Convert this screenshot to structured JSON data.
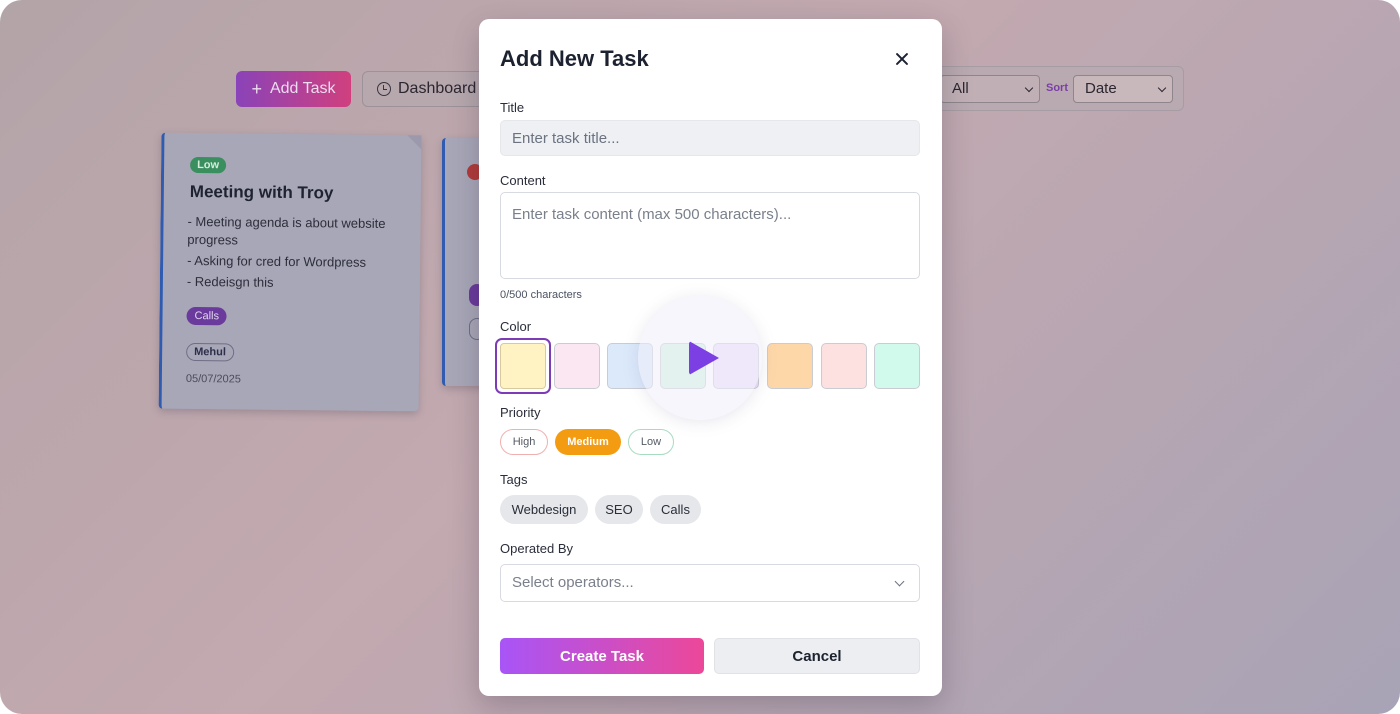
{
  "background": {
    "add_task_label": "Add Task",
    "dashboard_label": "Dashboard",
    "filter_value": "All",
    "sort_label": "Sort",
    "sort_value": "Date",
    "card1": {
      "priority": "Low",
      "title": "Meeting with Troy",
      "lines": [
        "- Meeting agenda is about website progress",
        "- Asking for cred for Wordpress",
        "- Redeisgn this"
      ],
      "tag": "Calls",
      "operator": "Mehul",
      "date": "05/07/2025"
    }
  },
  "modal": {
    "title": "Add New Task",
    "title_label": "Title",
    "title_placeholder": "Enter task title...",
    "content_label": "Content",
    "content_placeholder": "Enter task content (max 500 characters)...",
    "char_count": "0/500 characters",
    "color_label": "Color",
    "colors": [
      "#fff3c4",
      "#fbe7f1",
      "#dbe9fb",
      "#d6f5e3",
      "#ecdffb",
      "#fed7a8",
      "#fde0e0",
      "#d1faec"
    ],
    "selected_color_index": 0,
    "priority_label": "Priority",
    "priorities": [
      "High",
      "Medium",
      "Low"
    ],
    "selected_priority": "Medium",
    "tags_label": "Tags",
    "tags": [
      "Webdesign",
      "SEO",
      "Calls"
    ],
    "operated_by_label": "Operated By",
    "operators_placeholder": "Select operators...",
    "create_label": "Create Task",
    "cancel_label": "Cancel"
  },
  "video_overlay": {
    "icon": "play-icon",
    "accent": "#7b3fe4"
  }
}
